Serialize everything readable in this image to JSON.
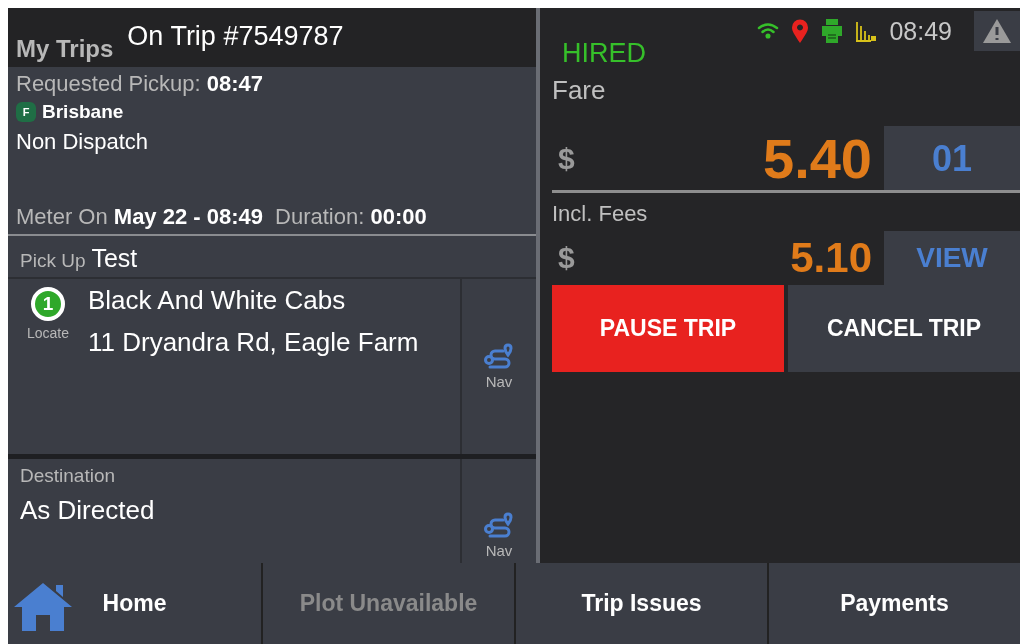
{
  "header": {
    "app_title": "My Trips",
    "trip_title": "On Trip #7549787"
  },
  "status": {
    "hire_state": "HIRED",
    "time": "08:49"
  },
  "trip": {
    "requested": "Requested Pickup: **08:47**",
    "fleet_badge": "F",
    "fleet_name": "Brisbane",
    "dispatch": "Non Dispatch",
    "meter": "Meter On **May 22 - 08:49**",
    "duration": "Duration: **00:00**"
  },
  "pickup": {
    "label": "Pick Up",
    "name": "Test",
    "stop_number": "1",
    "locate": "Locate",
    "business": "Black And White Cabs",
    "address": "11 Dryandra Rd, Eagle Farm",
    "nav": "Nav"
  },
  "destination": {
    "label": "Destination",
    "value": "As Directed",
    "nav": "Nav"
  },
  "fare": {
    "label": "Fare",
    "currency": "$",
    "amount": "5.40",
    "side": "01"
  },
  "fees": {
    "label": "Incl. Fees",
    "currency": "$",
    "amount": "5.10",
    "side": "VIEW"
  },
  "actions": [
    {
      "label": "PAUSE TRIP",
      "kind": "danger"
    },
    {
      "label": "CANCEL TRIP",
      "kind": "neutral"
    }
  ],
  "bottom_nav": [
    {
      "label": "Home",
      "disabled": false,
      "kind": "home"
    },
    {
      "label": "Plot Unavailable",
      "disabled": true,
      "kind": "plain"
    },
    {
      "label": "Trip Issues",
      "disabled": false,
      "kind": "plain"
    },
    {
      "label": "Payments",
      "disabled": false,
      "kind": "plain"
    }
  ]
}
